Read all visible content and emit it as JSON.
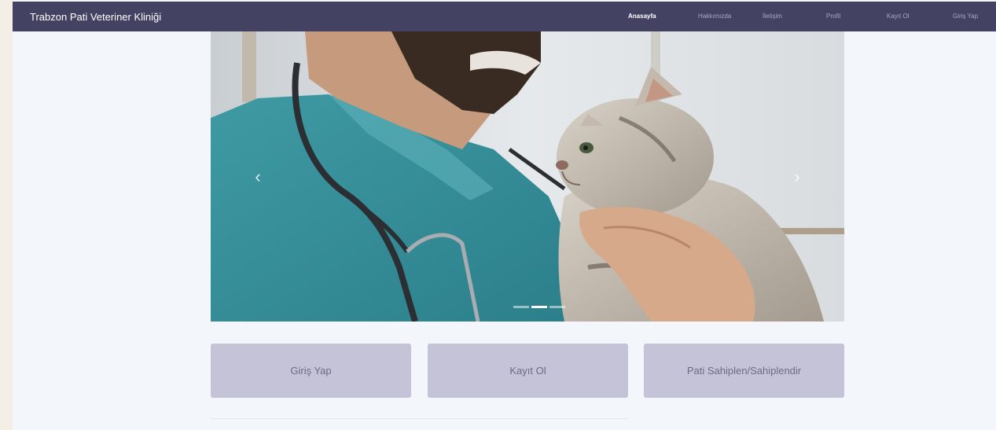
{
  "navbar": {
    "brand": "Trabzon Pati Veteriner Kliniği",
    "links": [
      {
        "label": "Anasayfa",
        "active": true
      },
      {
        "label": "Hakkımızda",
        "active": false
      },
      {
        "label": "İletişim",
        "active": false
      },
      {
        "label": "Profil",
        "active": false
      },
      {
        "label": "Kayıt Ol",
        "active": false
      },
      {
        "label": "Giriş Yap",
        "active": false
      }
    ]
  },
  "carousel": {
    "prev_icon": "chevron-left-icon",
    "next_icon": "chevron-right-icon",
    "prev_glyph": "‹",
    "next_glyph": "›",
    "slide_count": 3,
    "active_slide": 2
  },
  "actions": {
    "login_label": "Giriş Yap",
    "register_label": "Kayıt Ol",
    "adopt_label": "Pati Sahiplen/Sahiplendir"
  },
  "colors": {
    "navbar_bg": "#434263",
    "button_bg": "#c4c3d8",
    "button_text": "#6c6b86",
    "page_bg": "#f3f6fa"
  }
}
